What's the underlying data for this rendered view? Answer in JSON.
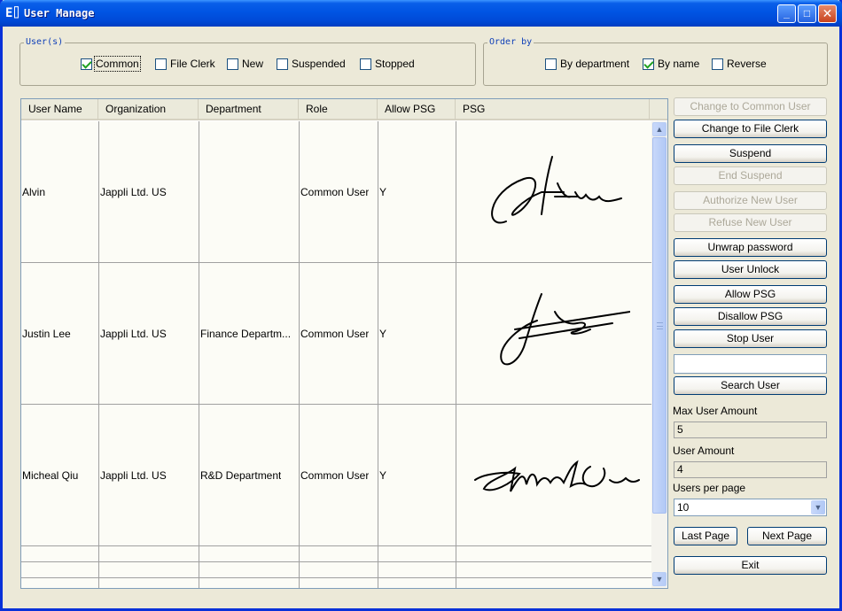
{
  "window": {
    "title": "User Manage",
    "icon": "app-icon",
    "icon_text": "E⌷"
  },
  "title_buttons": {
    "minimize": "_",
    "maximize": "□",
    "close": "✕"
  },
  "users_group": {
    "legend": "User(s)",
    "options": [
      {
        "label": "Common",
        "checked": true
      },
      {
        "label": "File Clerk",
        "checked": false
      },
      {
        "label": "New",
        "checked": false
      },
      {
        "label": "Suspended",
        "checked": false
      },
      {
        "label": "Stopped",
        "checked": false
      }
    ]
  },
  "order_group": {
    "legend": "Order by",
    "options": [
      {
        "label": "By department",
        "checked": false
      },
      {
        "label": "By name",
        "checked": true
      },
      {
        "label": "Reverse",
        "checked": false
      }
    ]
  },
  "table": {
    "columns": [
      "User Name",
      "Organization",
      "Department",
      "Role",
      "Allow PSG",
      "PSG"
    ],
    "rows": [
      {
        "user_name": "Alvin",
        "organization": "Jappli Ltd. US",
        "department": "",
        "role": "Common User",
        "allow_psg": "Y",
        "psg": "signature-alvin"
      },
      {
        "user_name": "Justin Lee",
        "organization": "Jappli Ltd. US",
        "department": "Finance Departm...",
        "role": "Common User",
        "allow_psg": "Y",
        "psg": "signature-justin"
      },
      {
        "user_name": "Micheal Qiu",
        "organization": "Jappli Ltd. US",
        "department": "R&D Department",
        "role": "Common User",
        "allow_psg": "Y",
        "psg": "signature-micheal"
      }
    ]
  },
  "actions": {
    "change_common": "Change to Common User",
    "change_file_clerk": "Change to File Clerk",
    "suspend": "Suspend",
    "end_suspend": "End Suspend",
    "authorize_new": "Authorize New User",
    "refuse_new": "Refuse New User",
    "unwrap_password": "Unwrap password",
    "user_unlock": "User Unlock",
    "allow_psg": "Allow PSG",
    "disallow_psg": "Disallow PSG",
    "stop_user": "Stop User",
    "search_user": "Search User",
    "last_page": "Last Page",
    "next_page": "Next Page",
    "exit": "Exit"
  },
  "search": {
    "value": ""
  },
  "stats": {
    "max_user_label": "Max User Amount",
    "max_user_value": "5",
    "user_amount_label": "User Amount",
    "user_amount_value": "4",
    "per_page_label": "Users per page",
    "per_page_value": "10"
  },
  "colors": {
    "title_bar": "#0054E3",
    "window_bg": "#ECE9D8",
    "check": "#21A121"
  }
}
